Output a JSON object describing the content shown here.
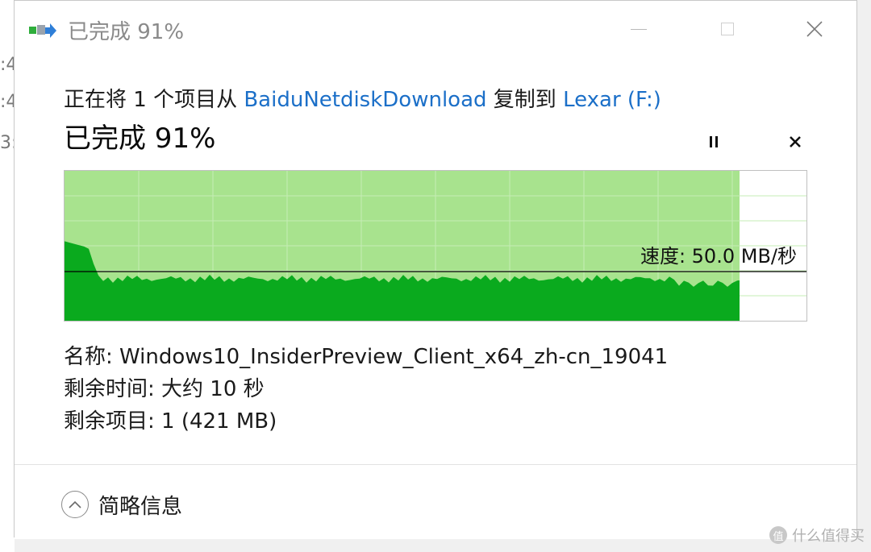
{
  "background": {
    "edge_glyphs": [
      ":4",
      ":4",
      "3:"
    ]
  },
  "window": {
    "title": "已完成 91%",
    "controls": {
      "minimize": "minimize",
      "maximize": "maximize",
      "close": "close"
    }
  },
  "copy": {
    "prefix": "正在将 1 个项目从 ",
    "source": "BaiduNetdiskDownload",
    "middle": " 复制到 ",
    "destination": "Lexar (F:)"
  },
  "progress": {
    "title": "已完成 91%",
    "percent": 91,
    "speed_label": "速度: 50.0 MB/秒"
  },
  "graph": {
    "colors": {
      "filled_bg": "#a8e38e",
      "throughput": "#0aaa1e",
      "speed_line": "#000000",
      "grid": "#c6ecb6"
    },
    "speed_ratio": 0.67
  },
  "details": {
    "name": "名称: Windows10_InsiderPreview_Client_x64_zh-cn_19041",
    "time_remaining": "剩余时间: 大约 10 秒",
    "items_remaining": "剩余项目: 1 (421 MB)"
  },
  "footer": {
    "toggle_label": "简略信息"
  },
  "watermark": {
    "badge": "值",
    "text": "什么值得买"
  },
  "icons": {
    "app": "copy-arrow-icon",
    "pause": "pause-icon",
    "stop": "stop-icon",
    "expand": "chevron-up-circle-icon"
  }
}
